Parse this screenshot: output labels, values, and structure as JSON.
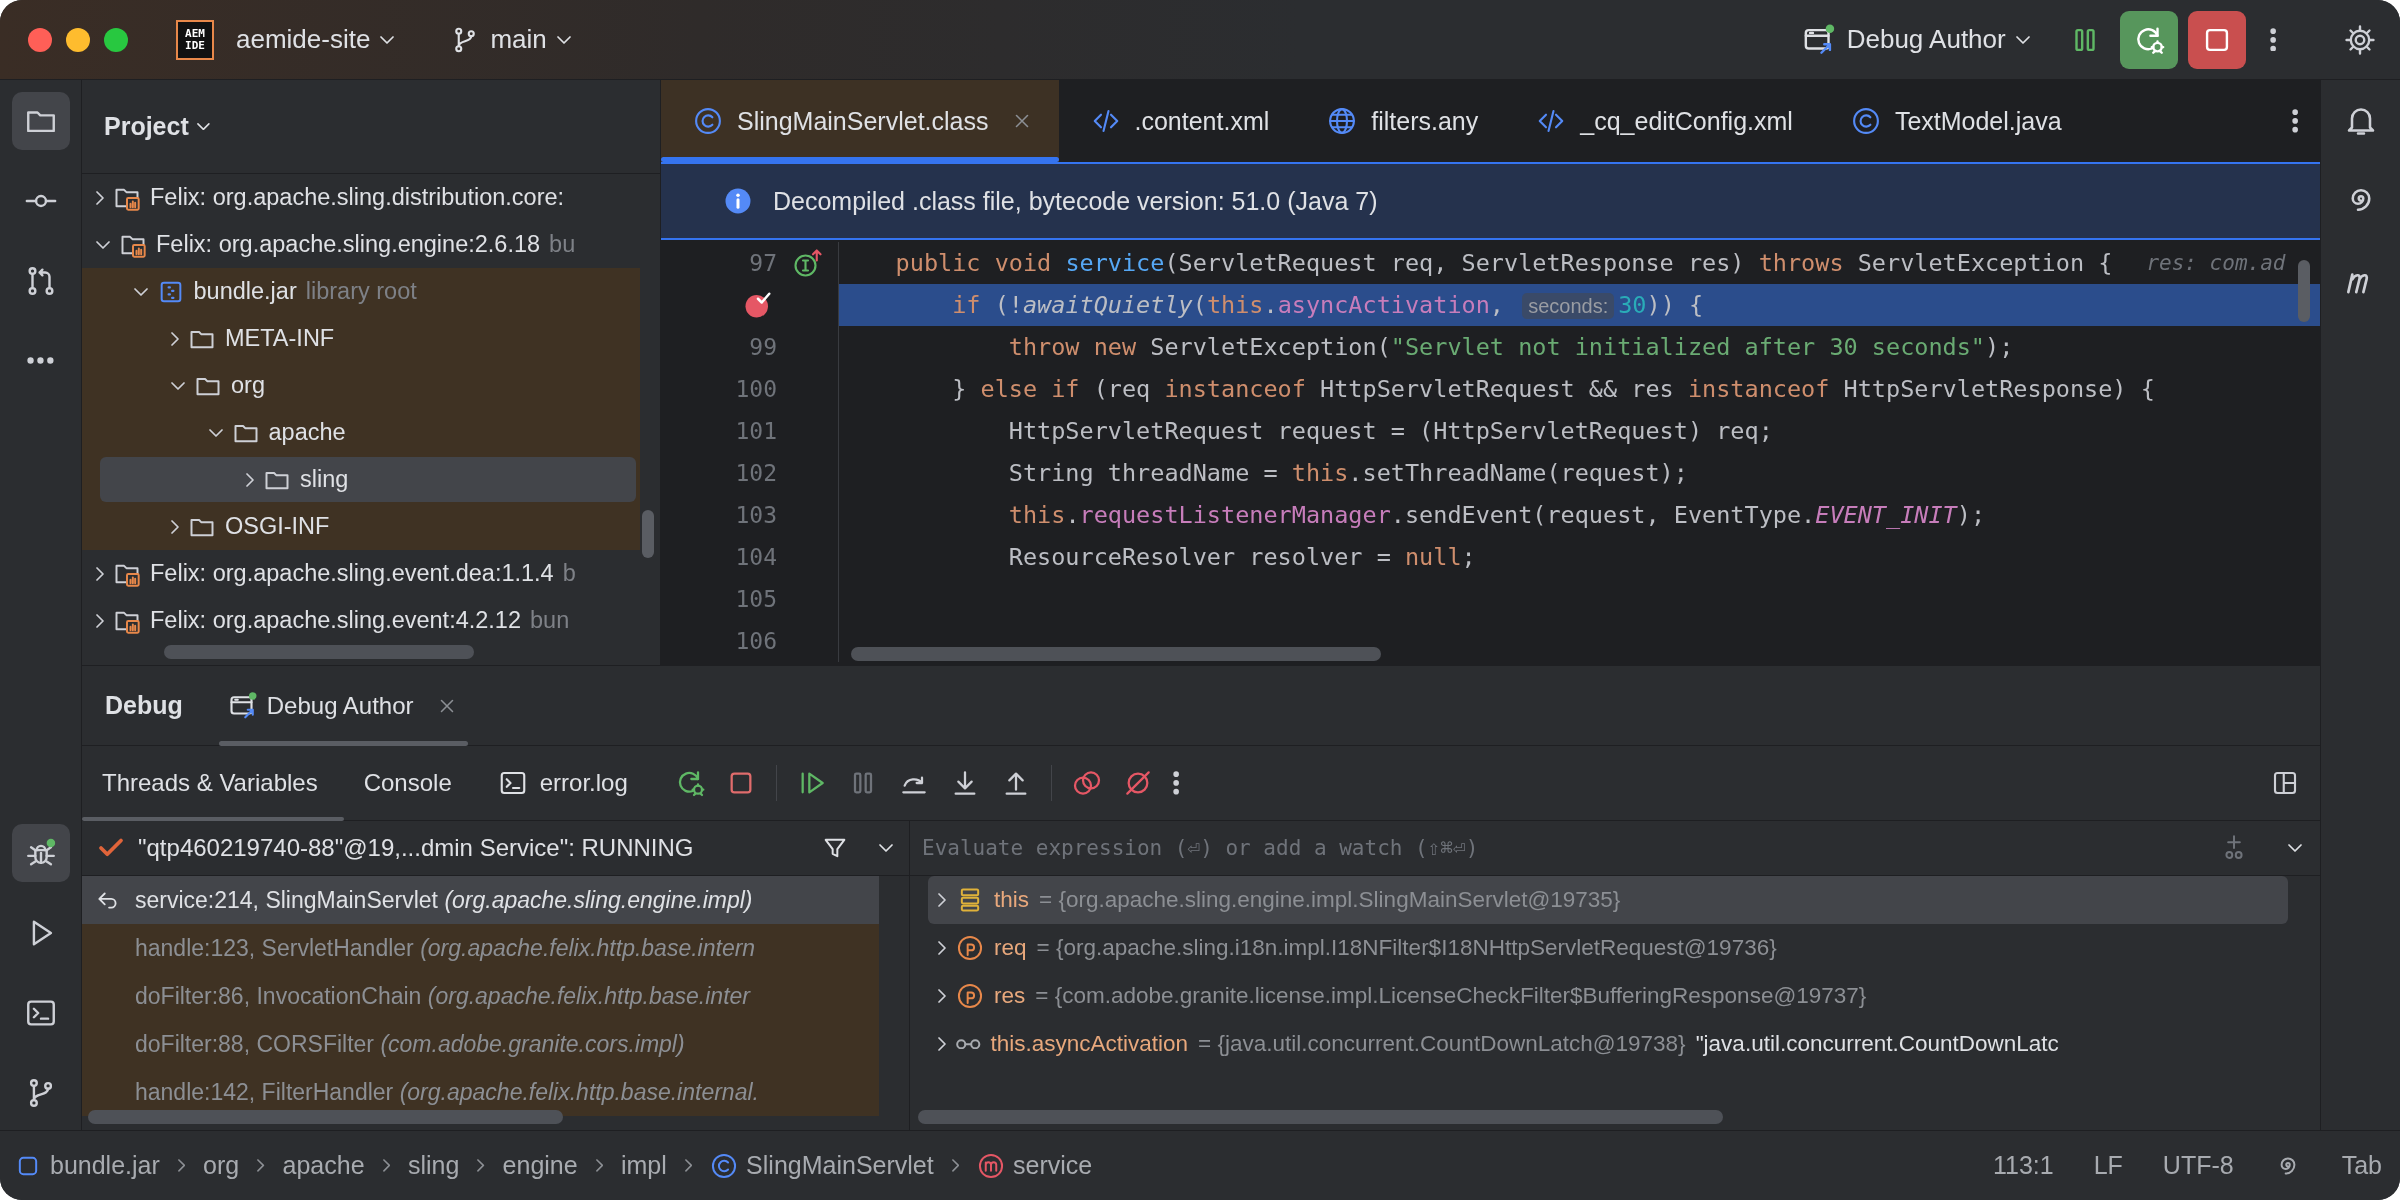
{
  "title_bar": {
    "logo_lines": [
      "AEM",
      "IDE"
    ],
    "project": "aemide-site",
    "branch": "main",
    "run_config": "Debug Author"
  },
  "left_toolbar": {
    "top": [
      {
        "kind": "project",
        "selected": true
      },
      {
        "kind": "commit",
        "selected": false
      },
      {
        "kind": "pull_requests",
        "selected": false
      },
      {
        "kind": "more",
        "selected": false
      }
    ],
    "bottom": [
      {
        "kind": "debug",
        "selected": true
      },
      {
        "kind": "run",
        "selected": false
      },
      {
        "kind": "terminal",
        "selected": false
      },
      {
        "kind": "git",
        "selected": false
      }
    ]
  },
  "project": {
    "title": "Project",
    "tree": [
      {
        "label": "Felix: org.apache.sling.distribution.core:",
        "kind": "library",
        "expanded": false,
        "selected": false,
        "library_scope": false
      },
      {
        "label": "Felix: org.apache.sling.engine:2.6.18",
        "hint": "bu",
        "kind": "library",
        "expanded": true,
        "selected": false,
        "library_scope": false,
        "children": [
          {
            "label": "bundle.jar",
            "hint": "library root",
            "kind": "jar",
            "expanded": true,
            "selected": false,
            "library_scope": true,
            "children": [
              {
                "label": "META-INF",
                "kind": "folder",
                "expanded": false,
                "selected": false,
                "library_scope": true
              },
              {
                "label": "org",
                "kind": "folder",
                "expanded": true,
                "selected": false,
                "library_scope": true,
                "children": [
                  {
                    "label": "apache",
                    "kind": "folder",
                    "expanded": true,
                    "selected": false,
                    "library_scope": true,
                    "children": [
                      {
                        "label": "sling",
                        "kind": "folder",
                        "expanded": false,
                        "selected": true,
                        "library_scope": true
                      }
                    ]
                  }
                ]
              },
              {
                "label": "OSGI-INF",
                "kind": "folder",
                "expanded": false,
                "selected": false,
                "library_scope": true
              }
            ]
          }
        ]
      },
      {
        "label": "Felix: org.apache.sling.event.dea:1.1.4",
        "hint": "b",
        "kind": "library",
        "expanded": false,
        "selected": false,
        "library_scope": false
      },
      {
        "label": "Felix: org.apache.sling.event:4.2.12",
        "hint": "bun",
        "kind": "library",
        "expanded": false,
        "selected": false,
        "library_scope": false
      }
    ]
  },
  "editor": {
    "tabs": [
      {
        "label": "SlingMainServlet.class",
        "kind": "class",
        "selected": true
      },
      {
        "label": ".content.xml",
        "kind": "xml",
        "selected": false
      },
      {
        "label": "filters.any",
        "kind": "globe",
        "selected": false
      },
      {
        "label": "_cq_editConfig.xml",
        "kind": "xml",
        "selected": false
      },
      {
        "label": "TextModel.java",
        "kind": "class",
        "selected": false
      }
    ],
    "banner": "Decompiled .class file, bytecode version: 51.0 (Java 7)",
    "lines": [
      {
        "number": "97",
        "kind": "implements",
        "current": false,
        "tokens": [
          {
            "text": "    public void ",
            "kind": "keyword"
          },
          {
            "text": "service",
            "kind": "method"
          },
          {
            "text": "(ServletRequest req, ServletResponse res) ",
            "kind": "plain"
          },
          {
            "text": "throws",
            "kind": "keyword"
          },
          {
            "text": " ServletException {",
            "kind": "plain"
          }
        ],
        "end_hint": "res: com.ad"
      },
      {
        "kind": "breakpoint",
        "current": true,
        "tokens": [
          {
            "text": "        if",
            "kind": "keyword"
          },
          {
            "text": " (!",
            "kind": "plain"
          },
          {
            "text": "awaitQuietly",
            "kind": "static_call"
          },
          {
            "text": "(",
            "kind": "plain"
          },
          {
            "text": "this",
            "kind": "keyword"
          },
          {
            "text": ".",
            "kind": "plain"
          },
          {
            "text": "asyncActivation",
            "kind": "field"
          },
          {
            "text": ", ",
            "kind": "plain"
          },
          {
            "text": "seconds:",
            "kind": "param_hint"
          },
          {
            "text": "30",
            "kind": "number"
          },
          {
            "text": ")) {",
            "kind": "plain"
          }
        ]
      },
      {
        "number": "99",
        "current": false,
        "tokens": [
          {
            "text": "            throw new ",
            "kind": "keyword"
          },
          {
            "text": "ServletException(",
            "kind": "plain"
          },
          {
            "text": "\"Servlet not initialized after 30 seconds\"",
            "kind": "string"
          },
          {
            "text": ");",
            "kind": "plain"
          }
        ]
      },
      {
        "number": "100",
        "current": false,
        "tokens": [
          {
            "text": "        } ",
            "kind": "plain"
          },
          {
            "text": "else if",
            "kind": "keyword"
          },
          {
            "text": " (req ",
            "kind": "plain"
          },
          {
            "text": "instanceof",
            "kind": "keyword"
          },
          {
            "text": " HttpServletRequest && res ",
            "kind": "plain"
          },
          {
            "text": "instanceof",
            "kind": "keyword"
          },
          {
            "text": " HttpServletResponse) {",
            "kind": "plain"
          }
        ]
      },
      {
        "number": "101",
        "current": false,
        "tokens": [
          {
            "text": "            HttpServletRequest request = (HttpServletRequest) req;",
            "kind": "plain"
          }
        ]
      },
      {
        "number": "102",
        "current": false,
        "tokens": [
          {
            "text": "            String threadName = ",
            "kind": "plain"
          },
          {
            "text": "this",
            "kind": "keyword"
          },
          {
            "text": ".setThreadName(request);",
            "kind": "plain"
          }
        ]
      },
      {
        "number": "103",
        "current": false,
        "tokens": [
          {
            "text": "            this",
            "kind": "keyword"
          },
          {
            "text": ".",
            "kind": "plain"
          },
          {
            "text": "requestListenerManager",
            "kind": "field"
          },
          {
            "text": ".sendEvent(request, EventType.",
            "kind": "plain"
          },
          {
            "text": "EVENT_INIT",
            "kind": "constant"
          },
          {
            "text": ");",
            "kind": "plain"
          }
        ]
      },
      {
        "number": "104",
        "current": false,
        "tokens": [
          {
            "text": "            ResourceResolver resolver = ",
            "kind": "plain"
          },
          {
            "text": "null",
            "kind": "keyword"
          },
          {
            "text": ";",
            "kind": "plain"
          }
        ]
      },
      {
        "number": "105",
        "current": false
      },
      {
        "number": "106",
        "current": false
      }
    ]
  },
  "debug": {
    "title": "Debug",
    "session_tab": "Debug Author",
    "tabs": [
      {
        "label": "Threads & Variables",
        "kind": "plain",
        "selected": true
      },
      {
        "label": "Console",
        "kind": "plain",
        "selected": false
      },
      {
        "label": "error.log",
        "kind": "log",
        "selected": false
      }
    ],
    "thread": "\"qtp460219740-88\"@19,...dmin Service\": RUNNING",
    "frames": [
      {
        "method": "service:214, SlingMainServlet",
        "package": "(org.apache.sling.engine.impl)",
        "selected": true,
        "library": false
      },
      {
        "method": "handle:123, ServletHandler",
        "package": "(org.apache.felix.http.base.intern",
        "selected": false,
        "library": true
      },
      {
        "method": "doFilter:86, InvocationChain",
        "package": "(org.apache.felix.http.base.inter",
        "selected": false,
        "library": true
      },
      {
        "method": "doFilter:88, CORSFilter",
        "package": "(com.adobe.granite.cors.impl)",
        "selected": false,
        "library": true
      },
      {
        "method": "handle:142, FilterHandler",
        "package": "(org.apache.felix.http.base.internal.",
        "selected": false,
        "library": true
      }
    ],
    "watch_placeholder": "Evaluate expression (⏎) or add a watch (⇧⌘⏎)",
    "variables": [
      {
        "kind": "object",
        "name": "this",
        "value": "= {org.apache.sling.engine.impl.SlingMainServlet@19735}",
        "selected": true
      },
      {
        "kind": "parameter",
        "name": "req",
        "value": "= {org.apache.sling.i18n.impl.I18NFilter$I18NHttpServletRequest@19736}",
        "selected": false
      },
      {
        "kind": "parameter",
        "name": "res",
        "value": "= {com.adobe.granite.license.impl.LicenseCheckFilter$BufferingResponse@19737}",
        "selected": false
      },
      {
        "kind": "watch",
        "name": "this.asyncActivation",
        "value": "= {java.util.concurrent.CountDownLatch@19738}",
        "display": "\"java.util.concurrent.CountDownLatc",
        "selected": false
      }
    ]
  },
  "status_bar": {
    "breadcrumbs": [
      {
        "label": "bundle.jar",
        "kind": "jar"
      },
      {
        "label": "org",
        "kind": "plain"
      },
      {
        "label": "apache",
        "kind": "plain"
      },
      {
        "label": "sling",
        "kind": "plain"
      },
      {
        "label": "engine",
        "kind": "plain"
      },
      {
        "label": "impl",
        "kind": "plain"
      },
      {
        "label": "SlingMainServlet",
        "kind": "class"
      },
      {
        "label": "service",
        "kind": "method"
      }
    ],
    "position": "113:1",
    "line_separator": "LF",
    "encoding": "UTF-8",
    "indent": "Tab"
  }
}
